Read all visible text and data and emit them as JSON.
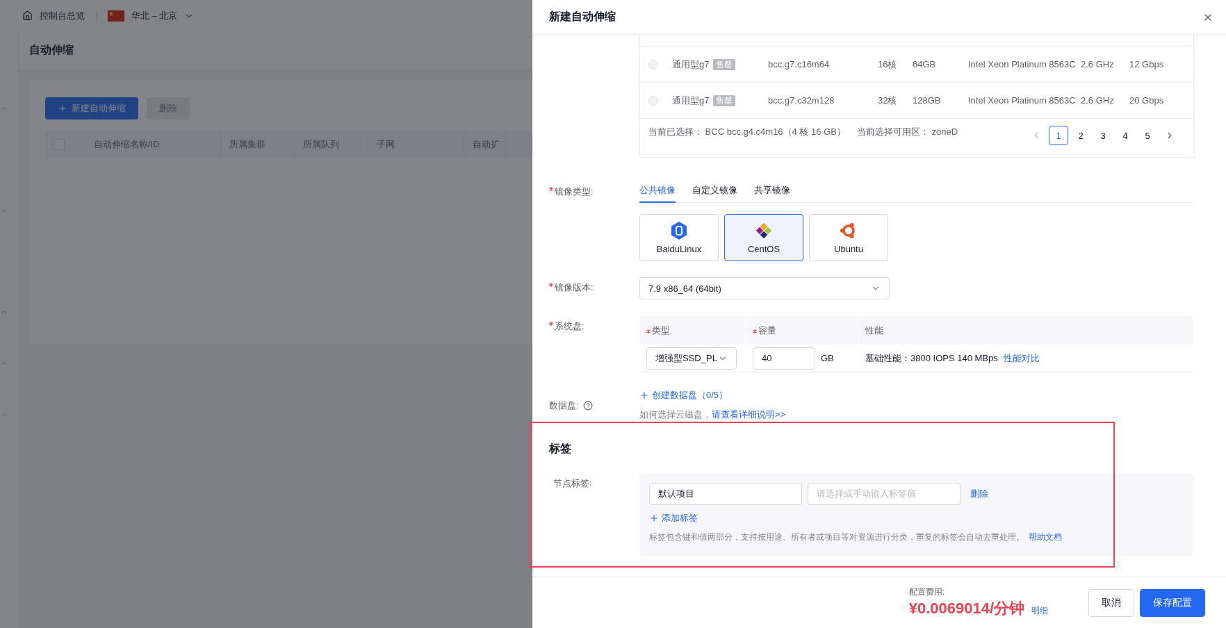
{
  "top_bar": {
    "home": "控制台总览",
    "region": "华北 – 北京"
  },
  "page": {
    "title": "自动伸缩",
    "buttons": [
      {
        "label": "新建自动伸缩",
        "kind": "primary"
      },
      {
        "label": "删除",
        "kind": "disabled"
      }
    ],
    "all_checked": false,
    "columns": [
      "自动伸缩名称/ID",
      "所属集群",
      "所属队列",
      "子网",
      "自动扩"
    ]
  },
  "drawer": {
    "title": "新建自动伸缩",
    "instance_table": {
      "rows": [
        {
          "selected": false,
          "family": "通用型g7",
          "badge": "售罄",
          "spec": "bcc.g7.c16m64",
          "cpu": "16核",
          "memory": "64GB",
          "processor": "Intel Xeon Platinum 8563C",
          "frequency": "2.6 GHz",
          "bandwidth": "12 Gbps"
        },
        {
          "selected": false,
          "family": "通用型g7",
          "badge": "售罄",
          "spec": "bcc.g7.c32m128",
          "cpu": "32核",
          "memory": "128GB",
          "processor": "Intel Xeon Platinum 8563C",
          "frequency": "2.6 GHz",
          "bandwidth": "20 Gbps"
        }
      ],
      "selection_text": "当前已选择： BCC bcc.g4.c4m16（4 核 16 GB）",
      "zone_text": "当前选择可用区： zoneD",
      "pages": [
        {
          "label": "1",
          "selected": true
        },
        {
          "label": "2",
          "selected": false
        },
        {
          "label": "3",
          "selected": false
        },
        {
          "label": "4",
          "selected": false
        },
        {
          "label": "5",
          "selected": false
        }
      ]
    },
    "image_type": {
      "label": "镜像类型:",
      "required": true,
      "tabs": [
        {
          "label": "公共镜像",
          "selected": true
        },
        {
          "label": "自定义镜像",
          "selected": false
        },
        {
          "label": "共享镜像",
          "selected": false
        }
      ],
      "images": [
        {
          "name": "BaiduLinux",
          "kind": "baidu",
          "selected": false
        },
        {
          "name": "CentOS",
          "kind": "centos",
          "selected": true
        },
        {
          "name": "Ubuntu",
          "kind": "ubuntu",
          "selected": false
        }
      ]
    },
    "image_version": {
      "label": "镜像版本:",
      "required": true,
      "value": "7.9 x86_64 (64bit)"
    },
    "system_disk": {
      "label": "系统盘:",
      "required": true,
      "columns": [
        {
          "label": "类型",
          "required": true
        },
        {
          "label": "容量",
          "required": true
        },
        {
          "label": "性能",
          "required": false
        }
      ],
      "type_value": "增强型SSD_PL",
      "size_value": "40",
      "unit": "GB",
      "performance": "基础性能：3800 IOPS 140 MBps",
      "compare_link": "性能对比"
    },
    "data_disk": {
      "label": "数据盘:",
      "create_link": "创建数据盘（0/5）",
      "hint": "如何选择云磁盘，",
      "hint_link": "请查看详细说明>>"
    },
    "tags": {
      "heading": "标签",
      "label": "节点标签:",
      "key_value": "默认项目",
      "value_placeholder": "请选择或手动输入标签值",
      "delete_link": "删除",
      "add_link": "添加标签",
      "hint": "标签包含键和值两部分，支持按用途、所有者或项目等对资源进行分类，重复的标签会自动去重处理。",
      "help_link": "帮助文档"
    },
    "footer": {
      "cost_label": "配置费用:",
      "price": "¥0.0069014/分钟",
      "detail_link": "明细",
      "cancel": "取消",
      "save": "保存配置"
    }
  }
}
